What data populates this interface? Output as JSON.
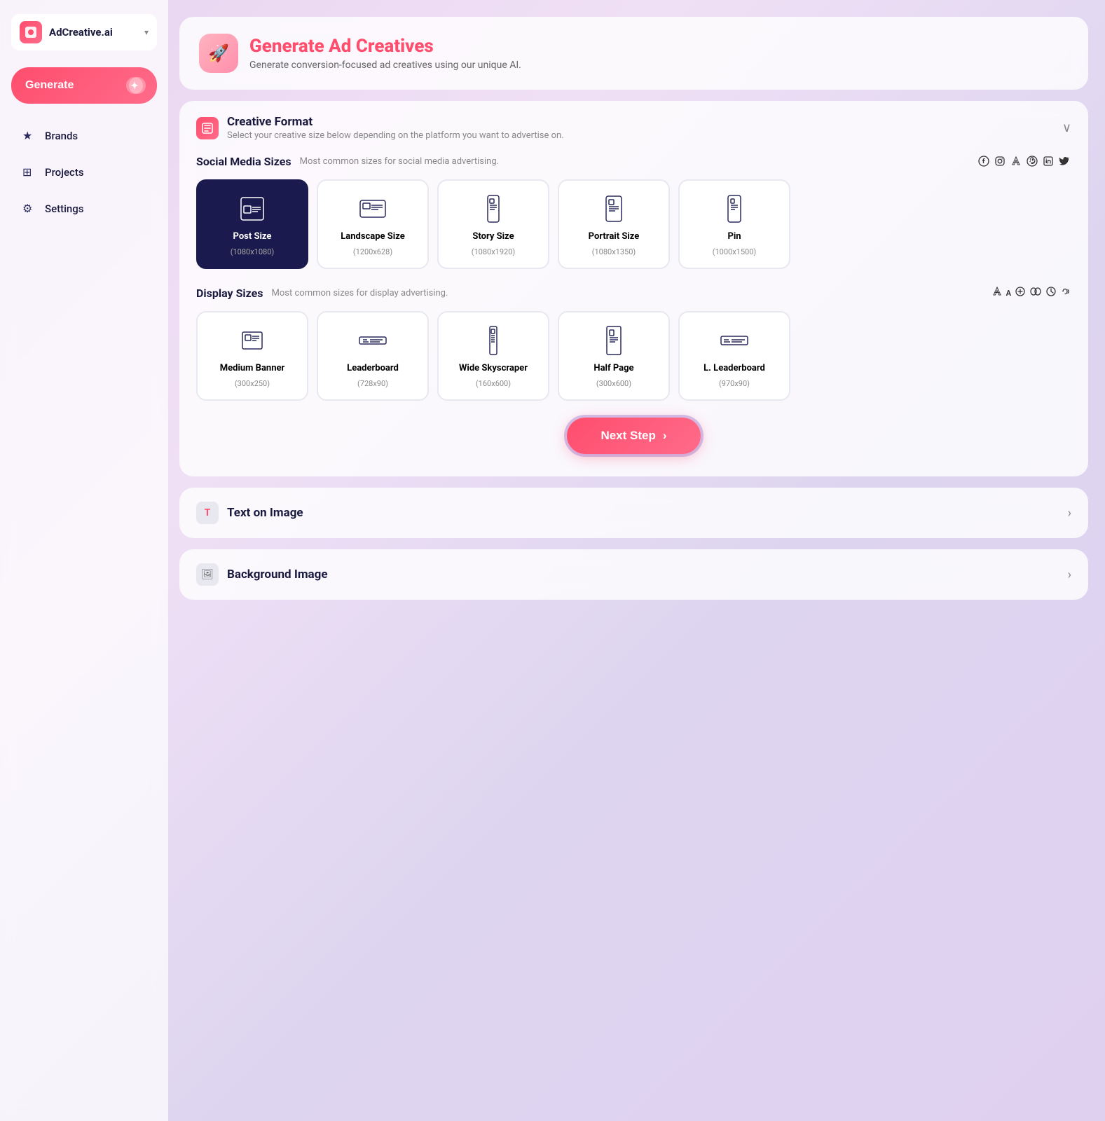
{
  "sidebar": {
    "logo": {
      "text": "AdCreative.ai",
      "chevron": "▾"
    },
    "generate_label": "Generate",
    "items": [
      {
        "id": "brands",
        "label": "Brands",
        "icon": "★"
      },
      {
        "id": "projects",
        "label": "Projects",
        "icon": "⊞"
      },
      {
        "id": "settings",
        "label": "Settings",
        "icon": "⚙"
      }
    ]
  },
  "header": {
    "title": "Generate Ad Creatives",
    "subtitle": "Generate conversion-focused ad creatives using our unique AI."
  },
  "creative_format": {
    "section_title": "Creative Format",
    "section_subtitle": "Select your creative size below depending on the platform you want to advertise on.",
    "social_media": {
      "title": "Social Media Sizes",
      "description": "Most common sizes for social media advertising.",
      "sizes": [
        {
          "id": "post",
          "name": "Post Size",
          "dimensions": "(1080x1080)",
          "selected": true,
          "shape": "square"
        },
        {
          "id": "landscape",
          "name": "Landscape Size",
          "dimensions": "(1200x628)",
          "selected": false,
          "shape": "landscape"
        },
        {
          "id": "story",
          "name": "Story Size",
          "dimensions": "(1080x1920)",
          "selected": false,
          "shape": "portrait_tall"
        },
        {
          "id": "portrait",
          "name": "Portrait Size",
          "dimensions": "(1080x1350)",
          "selected": false,
          "shape": "portrait"
        },
        {
          "id": "pin",
          "name": "Pin",
          "dimensions": "(1000x1500)",
          "selected": false,
          "shape": "pin"
        }
      ]
    },
    "display": {
      "title": "Display Sizes",
      "description": "Most common sizes for display advertising.",
      "sizes": [
        {
          "id": "medium_banner",
          "name": "Medium Banner",
          "dimensions": "(300x250)",
          "selected": false,
          "shape": "medium_banner"
        },
        {
          "id": "leaderboard",
          "name": "Leaderboard",
          "dimensions": "(728x90)",
          "selected": false,
          "shape": "leaderboard"
        },
        {
          "id": "wide_skyscraper",
          "name": "Wide Skyscraper",
          "dimensions": "(160x600)",
          "selected": false,
          "shape": "skyscraper"
        },
        {
          "id": "half_page",
          "name": "Half Page",
          "dimensions": "(300x600)",
          "selected": false,
          "shape": "half_page"
        },
        {
          "id": "l_leaderboard",
          "name": "L. Leaderboard",
          "dimensions": "(970x90)",
          "selected": false,
          "shape": "l_leaderboard"
        }
      ]
    },
    "next_step_label": "Next Step"
  },
  "text_on_image": {
    "title": "Text on Image"
  },
  "background_image": {
    "title": "Background Image"
  }
}
